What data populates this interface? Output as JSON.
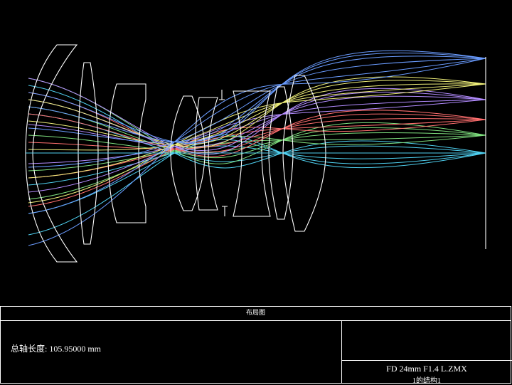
{
  "panel_title": "布局图",
  "total_length_label": "总轴长度:",
  "total_length_value": "105.95000 mm",
  "file_name": "FD 24mm F1.4 L.ZMX",
  "configuration": "1的结构1",
  "colors": {
    "background": "#000000",
    "lens_outline": "#ffffff",
    "field_1": "#4fd0f0",
    "field_2": "#7fe07f",
    "field_3": "#ff6f6f",
    "field_4": "#b38cff",
    "field_5": "#f0f07a",
    "field_6": "#6a9cff"
  }
}
